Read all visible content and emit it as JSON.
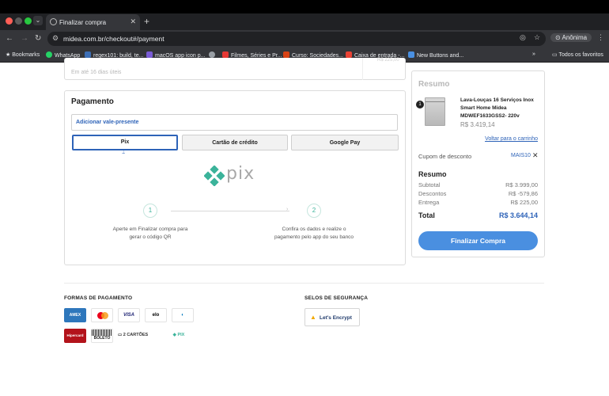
{
  "browser": {
    "tab_title": "Finalizar compra",
    "url": "midea.com.br/checkout#/payment",
    "profile_label": "Anônima",
    "bookmarks": [
      {
        "label": "Bookmarks",
        "color": "#cfcfcf"
      },
      {
        "label": "WhatsApp",
        "color": "#25d366"
      },
      {
        "label": "regex101: build, te...",
        "color": "#3d6fb6"
      },
      {
        "label": "macOS app icon p...",
        "color": "#7a5cd6"
      },
      {
        "label": "",
        "color": "#9aa0a6"
      },
      {
        "label": "Filmes, Séries e Pr...",
        "color": "#e53935"
      },
      {
        "label": "Curso: Sociedades...",
        "color": "#d84315"
      },
      {
        "label": "Caixa de entrada -...",
        "color": "#ea4335"
      },
      {
        "label": "New Buttons and...",
        "color": "#4a90e2"
      }
    ],
    "all_bookmarks": "Todos os favoritos"
  },
  "shipping_partial": {
    "text": "Em até 16 dias úteis",
    "price": "R$ 225,00"
  },
  "payment": {
    "title": "Pagamento",
    "voucher_label": "Adicionar vale-presente",
    "tabs": [
      "Pix",
      "Cartão de crédito",
      "Google Pay"
    ],
    "logo_text": "pix",
    "steps": [
      {
        "num": "1",
        "text": "Aperte em Finalizar compra para gerar o código QR"
      },
      {
        "num": "2",
        "text": "Confira os dados e realize o pagamento pelo app do seu banco"
      }
    ]
  },
  "summary": {
    "title": "Resumo",
    "product": {
      "qty": "1",
      "name": "Lava-Louças 16 Serviços Inox Smart Home Midea MDWEF1633GSS2- 220v",
      "price": "R$ 3.419,14"
    },
    "back_link": "Voltar para o carrinho",
    "coupon_label": "Cupom de desconto",
    "coupon_code": "MAIS10",
    "totals_title": "Resumo",
    "rows": [
      {
        "label": "Subtotal",
        "value": "R$ 3.999,00"
      },
      {
        "label": "Descontos",
        "value": "R$ -579,86"
      },
      {
        "label": "Entrega",
        "value": "R$ 225,00"
      }
    ],
    "total_label": "Total",
    "total_value": "R$ 3.644,14",
    "finish_button": "Finalizar Compra"
  },
  "footer": {
    "payment_title": "FORMAS DE PAGAMENTO",
    "security_title": "SELOS DE SEGURANÇA",
    "payment_icons": [
      "AMEX",
      "",
      "VISA",
      "elo",
      "",
      "Hipercard",
      "BOLETO",
      "2 CARTÕES",
      "PIX"
    ],
    "security_badge": "Let's Encrypt"
  },
  "colors": {
    "accent_blue": "#2e63b8",
    "pix_teal": "#3bb39a",
    "button_blue": "#4a8fe0"
  }
}
